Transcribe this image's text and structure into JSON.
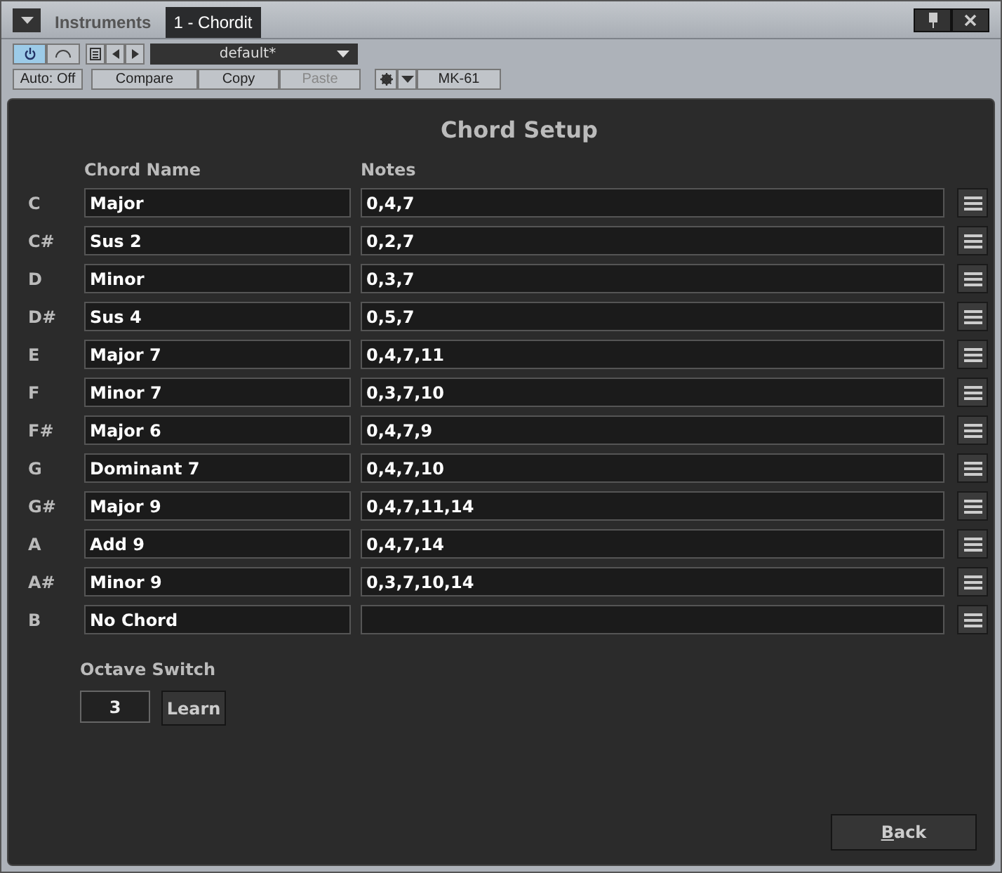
{
  "tabs": [
    {
      "label": "Instruments",
      "selected": false
    },
    {
      "label": "1 - Chordit",
      "selected": true
    }
  ],
  "toolbar": {
    "power_on": true,
    "preset": "default*",
    "auto": "Auto: Off",
    "buttons": [
      {
        "label": "Compare",
        "disabled": false
      },
      {
        "label": "Copy",
        "disabled": false
      },
      {
        "label": "Paste",
        "disabled": true
      }
    ],
    "device": "MK-61"
  },
  "title": "Chord Setup",
  "columns": [
    "Chord Name",
    "Notes"
  ],
  "chords": [
    {
      "key": "C",
      "name": "Major",
      "notes": "0,4,7"
    },
    {
      "key": "C#",
      "name": "Sus 2",
      "notes": "0,2,7"
    },
    {
      "key": "D",
      "name": "Minor",
      "notes": "0,3,7"
    },
    {
      "key": "D#",
      "name": "Sus 4",
      "notes": "0,5,7"
    },
    {
      "key": "E",
      "name": "Major 7",
      "notes": "0,4,7,11"
    },
    {
      "key": "F",
      "name": "Minor 7",
      "notes": "0,3,7,10"
    },
    {
      "key": "F#",
      "name": "Major 6",
      "notes": "0,4,7,9"
    },
    {
      "key": "G",
      "name": "Dominant 7",
      "notes": "0,4,7,10"
    },
    {
      "key": "G#",
      "name": "Major 9",
      "notes": "0,4,7,11,14"
    },
    {
      "key": "A",
      "name": "Add 9",
      "notes": "0,4,7,14"
    },
    {
      "key": "A#",
      "name": "Minor 9",
      "notes": "0,3,7,10,14"
    },
    {
      "key": "B",
      "name": "No Chord"
    }
  ],
  "octave": {
    "label": "Octave Switch",
    "value": "3",
    "button": "Learn"
  },
  "back_button": "Back"
}
